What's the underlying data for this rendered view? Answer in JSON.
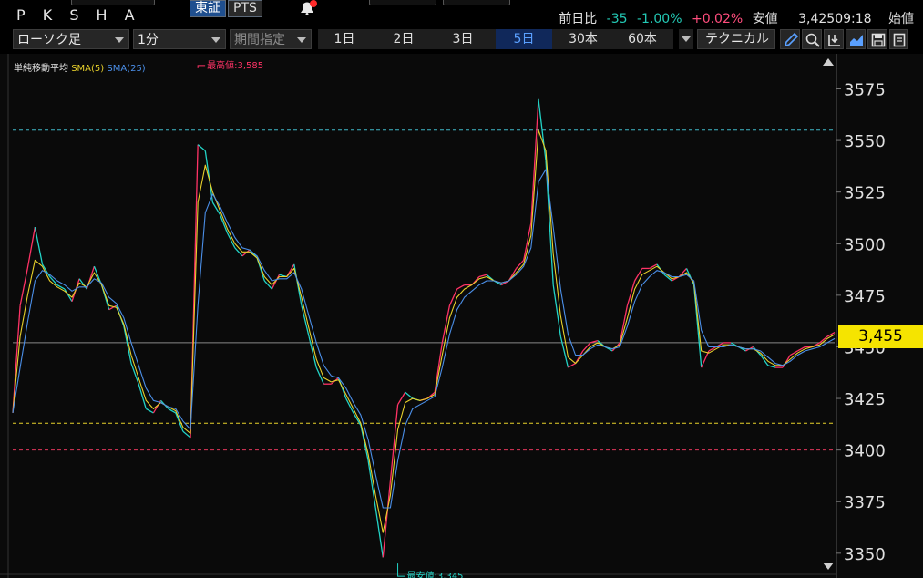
{
  "header": {
    "ticker": "P K S H A",
    "market_tse": "東証",
    "market_pts": "PTS",
    "prev_label": "前日比",
    "change": "-35",
    "change_pct": "-1.00%",
    "extra_pct": "+0.02%",
    "low_label": "安値",
    "low_value": "3,425",
    "time": "09:18",
    "open_label": "始値"
  },
  "toolbar": {
    "chart_type": "ローソク足",
    "interval": "1分",
    "period_select": "期間指定",
    "periods": [
      {
        "label": "1日",
        "active": false
      },
      {
        "label": "2日",
        "active": false
      },
      {
        "label": "3日",
        "active": false
      },
      {
        "label": "5日",
        "active": true
      },
      {
        "label": "30本",
        "active": false
      },
      {
        "label": "60本",
        "active": false
      }
    ],
    "technical": "テクニカル",
    "icons": [
      "pen-icon",
      "zoom-icon",
      "output-icon",
      "area-chart-icon",
      "save-icon",
      "page-icon"
    ]
  },
  "legend": {
    "title": "単純移動平均",
    "sma5": "SMA(5)",
    "sma25": "SMA(25)"
  },
  "colors": {
    "up": "#ff3366",
    "down": "#22d3c6",
    "sma5": "#e8d12b",
    "sma25": "#4b8fe8",
    "line_high": "#3fb7c7",
    "line_mid": "#e8d12b",
    "line_low": "#e0365a",
    "tag": "#f5e400"
  },
  "chart_data": {
    "type": "line",
    "ylim": [
      3338,
      3592
    ],
    "yticks": [
      3350,
      3375,
      3400,
      3425,
      3450,
      3475,
      3500,
      3525,
      3550,
      3575
    ],
    "ytick_labels": [
      "3350",
      "3375",
      "3400",
      "3425",
      "3450",
      "3475",
      "3500",
      "3525",
      "3550",
      "3575"
    ],
    "current_price": 3455,
    "current_price_label": "3,455",
    "hlines": [
      {
        "y": 3555,
        "style": "dashed",
        "color": "#3fb7c7"
      },
      {
        "y": 3413,
        "style": "dashed",
        "color": "#e8d12b"
      },
      {
        "y": 3400,
        "style": "dashed",
        "color": "#e0365a"
      },
      {
        "y": 3452,
        "style": "solid",
        "color": "#888888"
      }
    ],
    "annotations": [
      {
        "text": "最高値:3,585",
        "y": 3585,
        "x_index": 25,
        "color": "#ff3366"
      },
      {
        "text": "最安値:3,345",
        "y": 3345,
        "x_index": 52,
        "color": "#22d3c6"
      }
    ],
    "series": [
      {
        "name": "price",
        "values": [
          3418,
          3470,
          3488,
          3508,
          3490,
          3484,
          3480,
          3478,
          3472,
          3483,
          3478,
          3489,
          3480,
          3468,
          3470,
          3460,
          3442,
          3432,
          3420,
          3418,
          3424,
          3420,
          3418,
          3409,
          3406,
          3548,
          3545,
          3520,
          3514,
          3505,
          3498,
          3494,
          3497,
          3493,
          3482,
          3478,
          3485,
          3484,
          3490,
          3470,
          3455,
          3440,
          3432,
          3432,
          3435,
          3425,
          3418,
          3412,
          3395,
          3372,
          3348,
          3385,
          3422,
          3428,
          3425,
          3424,
          3425,
          3428,
          3452,
          3470,
          3478,
          3480,
          3480,
          3484,
          3485,
          3482,
          3480,
          3482,
          3488,
          3492,
          3510,
          3570,
          3540,
          3480,
          3455,
          3440,
          3442,
          3448,
          3452,
          3453,
          3450,
          3448,
          3452,
          3470,
          3482,
          3488,
          3488,
          3490,
          3485,
          3482,
          3484,
          3488,
          3480,
          3440,
          3448,
          3450,
          3452,
          3452,
          3450,
          3448,
          3450,
          3446,
          3441,
          3440,
          3440,
          3446,
          3448,
          3450,
          3450,
          3452,
          3455,
          3457
        ]
      },
      {
        "name": "SMA(5)",
        "values": [
          3418,
          3455,
          3475,
          3492,
          3489,
          3482,
          3479,
          3477,
          3474,
          3481,
          3479,
          3486,
          3480,
          3470,
          3469,
          3461,
          3446,
          3435,
          3424,
          3420,
          3423,
          3421,
          3419,
          3411,
          3408,
          3520,
          3538,
          3525,
          3516,
          3507,
          3500,
          3496,
          3496,
          3493,
          3484,
          3480,
          3484,
          3484,
          3488,
          3474,
          3459,
          3444,
          3435,
          3433,
          3434,
          3427,
          3420,
          3413,
          3398,
          3378,
          3360,
          3378,
          3410,
          3423,
          3425,
          3424,
          3425,
          3427,
          3446,
          3464,
          3474,
          3478,
          3480,
          3483,
          3484,
          3482,
          3481,
          3482,
          3486,
          3490,
          3504,
          3555,
          3545,
          3495,
          3465,
          3445,
          3442,
          3446,
          3450,
          3452,
          3450,
          3449,
          3451,
          3464,
          3478,
          3485,
          3487,
          3489,
          3486,
          3483,
          3484,
          3486,
          3481,
          3448,
          3447,
          3449,
          3451,
          3451,
          3450,
          3449,
          3449,
          3447,
          3443,
          3441,
          3441,
          3444,
          3447,
          3449,
          3450,
          3451,
          3454,
          3456
        ]
      },
      {
        "name": "SMA(25)",
        "values": [
          3418,
          3440,
          3462,
          3482,
          3487,
          3485,
          3482,
          3480,
          3477,
          3479,
          3479,
          3483,
          3481,
          3474,
          3471,
          3464,
          3452,
          3441,
          3430,
          3424,
          3423,
          3421,
          3420,
          3414,
          3410,
          3470,
          3515,
          3524,
          3518,
          3510,
          3503,
          3498,
          3497,
          3494,
          3487,
          3482,
          3483,
          3483,
          3486,
          3478,
          3465,
          3452,
          3441,
          3436,
          3435,
          3430,
          3423,
          3417,
          3405,
          3388,
          3372,
          3372,
          3395,
          3412,
          3420,
          3422,
          3424,
          3426,
          3440,
          3456,
          3468,
          3474,
          3477,
          3480,
          3482,
          3482,
          3481,
          3482,
          3485,
          3489,
          3498,
          3530,
          3536,
          3508,
          3478,
          3456,
          3446,
          3446,
          3449,
          3451,
          3450,
          3449,
          3450,
          3460,
          3472,
          3480,
          3484,
          3487,
          3486,
          3484,
          3484,
          3485,
          3482,
          3458,
          3450,
          3450,
          3450,
          3451,
          3450,
          3449,
          3449,
          3448,
          3445,
          3442,
          3441,
          3443,
          3446,
          3448,
          3449,
          3450,
          3452,
          3454
        ]
      }
    ]
  }
}
